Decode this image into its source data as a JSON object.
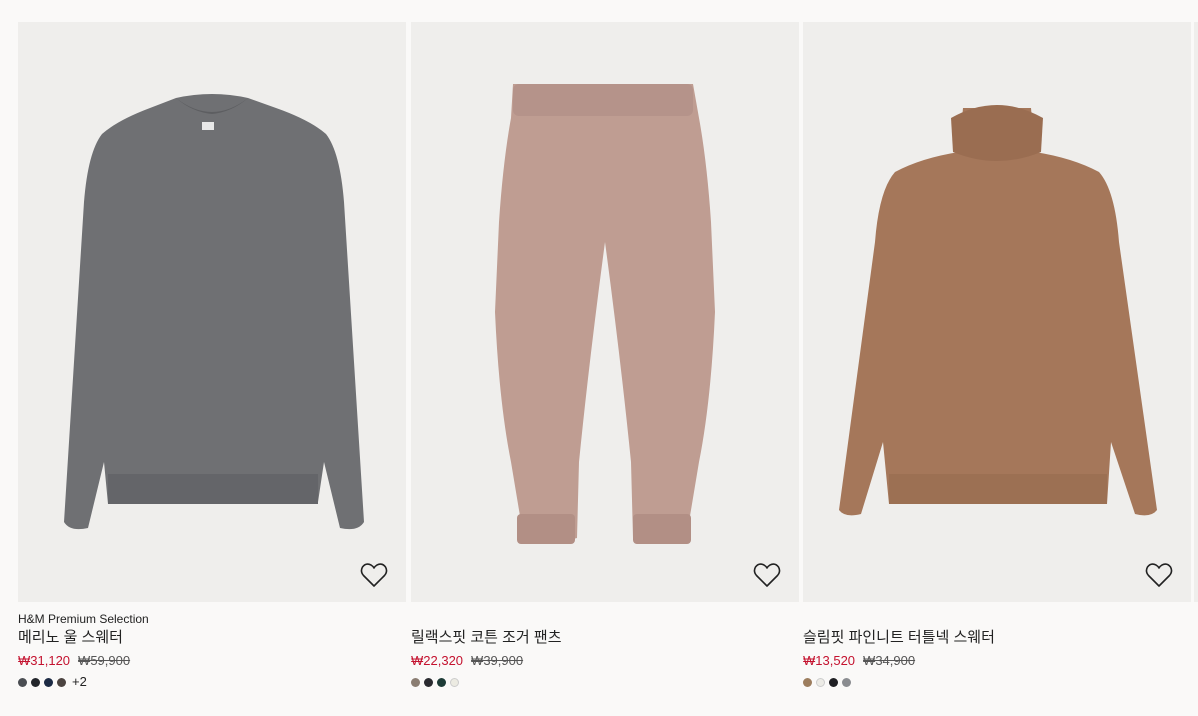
{
  "products": [
    {
      "brand": "H&M Premium Selection",
      "name": "메리노 울 스웨터",
      "sale_price": "₩31,120",
      "original_price": "₩59,900",
      "swatch_colors": [
        "#4a4d52",
        "#23262b",
        "#1c2a44",
        "#4b4340"
      ],
      "more_colors": "+2",
      "favorite_icon": "heart-outline-icon"
    },
    {
      "brand": "",
      "name": "릴랙스핏 코튼 조거 팬츠",
      "sale_price": "₩22,320",
      "original_price": "₩39,900",
      "swatch_colors": [
        "#8a7d72",
        "#2a2b30",
        "#1d3b36",
        "#ecebe2"
      ],
      "more_colors": "",
      "favorite_icon": "heart-outline-icon"
    },
    {
      "brand": "",
      "name": "슬림핏 파인니트 터틀넥 스웨터",
      "sale_price": "₩13,520",
      "original_price": "₩34,900",
      "swatch_colors": [
        "#9c7d5e",
        "#ecebe6",
        "#1f1f23",
        "#8a8c90"
      ],
      "more_colors": "",
      "favorite_icon": "heart-outline-icon"
    }
  ],
  "colors": {
    "sale_price": "#c4122f",
    "background": "#faf9f8",
    "photo_background": "#efeeec"
  }
}
